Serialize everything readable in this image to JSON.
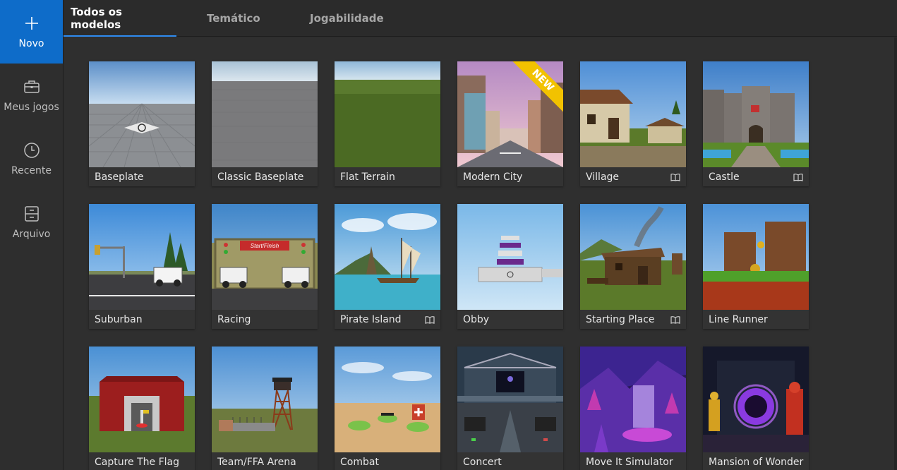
{
  "sidebar": {
    "items": [
      {
        "label": "Novo",
        "icon": "plus-icon"
      },
      {
        "label": "Meus jogos",
        "icon": "briefcase-icon"
      },
      {
        "label": "Recente",
        "icon": "clock-icon"
      },
      {
        "label": "Arquivo",
        "icon": "archive-icon"
      }
    ]
  },
  "tabs": [
    {
      "label": "Todos os modelos"
    },
    {
      "label": "Temático"
    },
    {
      "label": "Jogabilidade"
    }
  ],
  "templates": [
    {
      "title": "Baseplate",
      "tutorial": false
    },
    {
      "title": "Classic Baseplate",
      "tutorial": false
    },
    {
      "title": "Flat Terrain",
      "tutorial": false
    },
    {
      "title": "Modern City",
      "tutorial": false,
      "badge": "NEW"
    },
    {
      "title": "Village",
      "tutorial": true
    },
    {
      "title": "Castle",
      "tutorial": true
    },
    {
      "title": "Suburban",
      "tutorial": false
    },
    {
      "title": "Racing",
      "tutorial": false,
      "sign": "Start/Finish"
    },
    {
      "title": "Pirate Island",
      "tutorial": true
    },
    {
      "title": "Obby",
      "tutorial": false
    },
    {
      "title": "Starting Place",
      "tutorial": true
    },
    {
      "title": "Line Runner",
      "tutorial": false
    },
    {
      "title": "Capture The Flag",
      "tutorial": false
    },
    {
      "title": "Team/FFA Arena",
      "tutorial": false
    },
    {
      "title": "Combat",
      "tutorial": false
    },
    {
      "title": "Concert",
      "tutorial": false
    },
    {
      "title": "Move It Simulator",
      "tutorial": false
    },
    {
      "title": "Mansion of Wonder",
      "tutorial": false
    }
  ],
  "colors": {
    "accent": "#0e6cc9",
    "tab_underline": "#2f8bf0",
    "badge": "#f2c200"
  }
}
